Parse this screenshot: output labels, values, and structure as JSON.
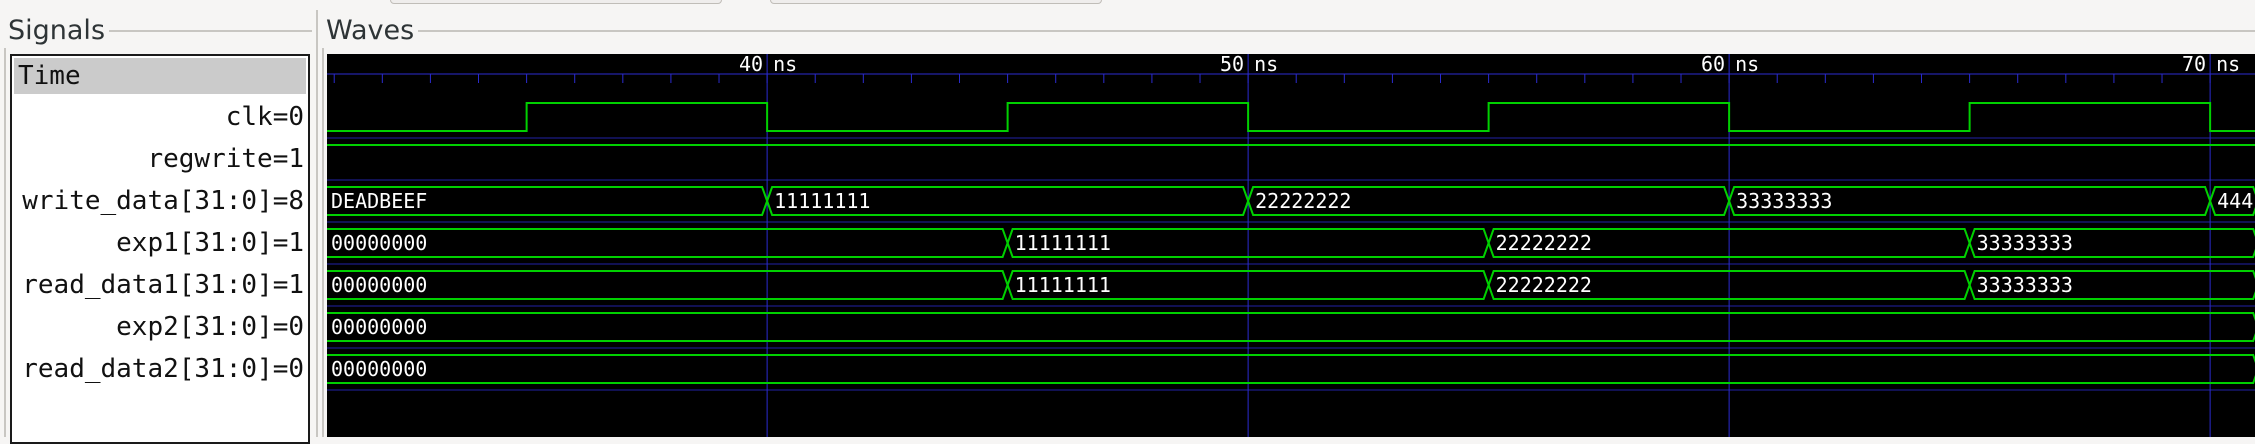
{
  "panels": {
    "signals_title": "Signals",
    "waves_title": "Waves"
  },
  "time_header": "Time",
  "signals": [
    {
      "name": "clk",
      "value": "=0"
    },
    {
      "name": "regwrite",
      "value": "=1"
    },
    {
      "name": "write_data[31:0]",
      "value": "=8"
    },
    {
      "name": "exp1[31:0]",
      "value": "=1"
    },
    {
      "name": "read_data1[31:0]",
      "value": "=1"
    },
    {
      "name": "exp2[31:0]",
      "value": "=0"
    },
    {
      "name": "read_data2[31:0]",
      "value": "=0"
    }
  ],
  "timeline": {
    "unit": "ns",
    "start_ns": 30.85,
    "major_ticks": [
      40,
      50,
      60,
      70
    ],
    "minor_step_ns": 1
  },
  "waves": {
    "clk": {
      "type": "clock",
      "high_intervals": [
        [
          35,
          40
        ],
        [
          45,
          50
        ],
        [
          55,
          60
        ],
        [
          65,
          70
        ]
      ]
    },
    "regwrite": {
      "type": "bit",
      "level": 1
    },
    "write_data": {
      "type": "bus",
      "segments": [
        {
          "start": 30.85,
          "end": 40,
          "label": "DEADBEEF"
        },
        {
          "start": 40,
          "end": 50,
          "label": "11111111"
        },
        {
          "start": 50,
          "end": 60,
          "label": "22222222"
        },
        {
          "start": 60,
          "end": 70,
          "label": "33333333"
        },
        {
          "start": 70,
          "end": 71,
          "label": "444"
        }
      ]
    },
    "exp1": {
      "type": "bus",
      "segments": [
        {
          "start": 30.85,
          "end": 45,
          "label": "00000000"
        },
        {
          "start": 45,
          "end": 55,
          "label": "11111111"
        },
        {
          "start": 55,
          "end": 65,
          "label": "22222222"
        },
        {
          "start": 65,
          "end": 71,
          "label": "33333333"
        }
      ]
    },
    "read_data1": {
      "type": "bus",
      "segments": [
        {
          "start": 30.85,
          "end": 45,
          "label": "00000000"
        },
        {
          "start": 45,
          "end": 55,
          "label": "11111111"
        },
        {
          "start": 55,
          "end": 65,
          "label": "22222222"
        },
        {
          "start": 65,
          "end": 71,
          "label": "33333333"
        }
      ]
    },
    "exp2": {
      "type": "bus",
      "segments": [
        {
          "start": 30.85,
          "end": 71,
          "label": "00000000"
        }
      ]
    },
    "read_data2": {
      "type": "bus",
      "segments": [
        {
          "start": 30.85,
          "end": 71,
          "label": "00000000"
        }
      ]
    }
  },
  "colors": {
    "wave": "#00d000",
    "grid": "#2b2bd0",
    "background": "#000000"
  }
}
